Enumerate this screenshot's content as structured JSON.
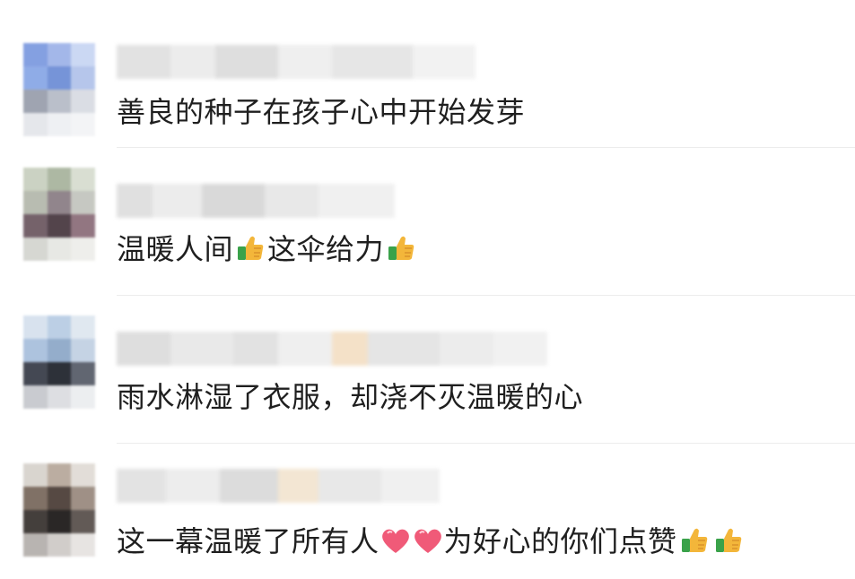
{
  "comments": [
    {
      "text": "善良的种子在孩子心中开始发芽",
      "emojis": []
    },
    {
      "text_parts": [
        "温暖人间",
        "这伞给力",
        ""
      ],
      "emojis": [
        "thumbs-up",
        "thumbs-up"
      ]
    },
    {
      "text": "雨水淋湿了衣服，却浇不灭温暖的心",
      "emojis": []
    },
    {
      "text_a": "这一幕温暖了所有人",
      "text_b": "为好心的你们点赞",
      "emojis": [
        "red-heart",
        "red-heart",
        "thumbs-up",
        "thumbs-up"
      ]
    }
  ],
  "colors": {
    "text": "#1f1f1f",
    "divider": "#ececec",
    "heart": "#f05a78",
    "thumb": "#f3b63a",
    "cuff": "#3aa24a"
  }
}
